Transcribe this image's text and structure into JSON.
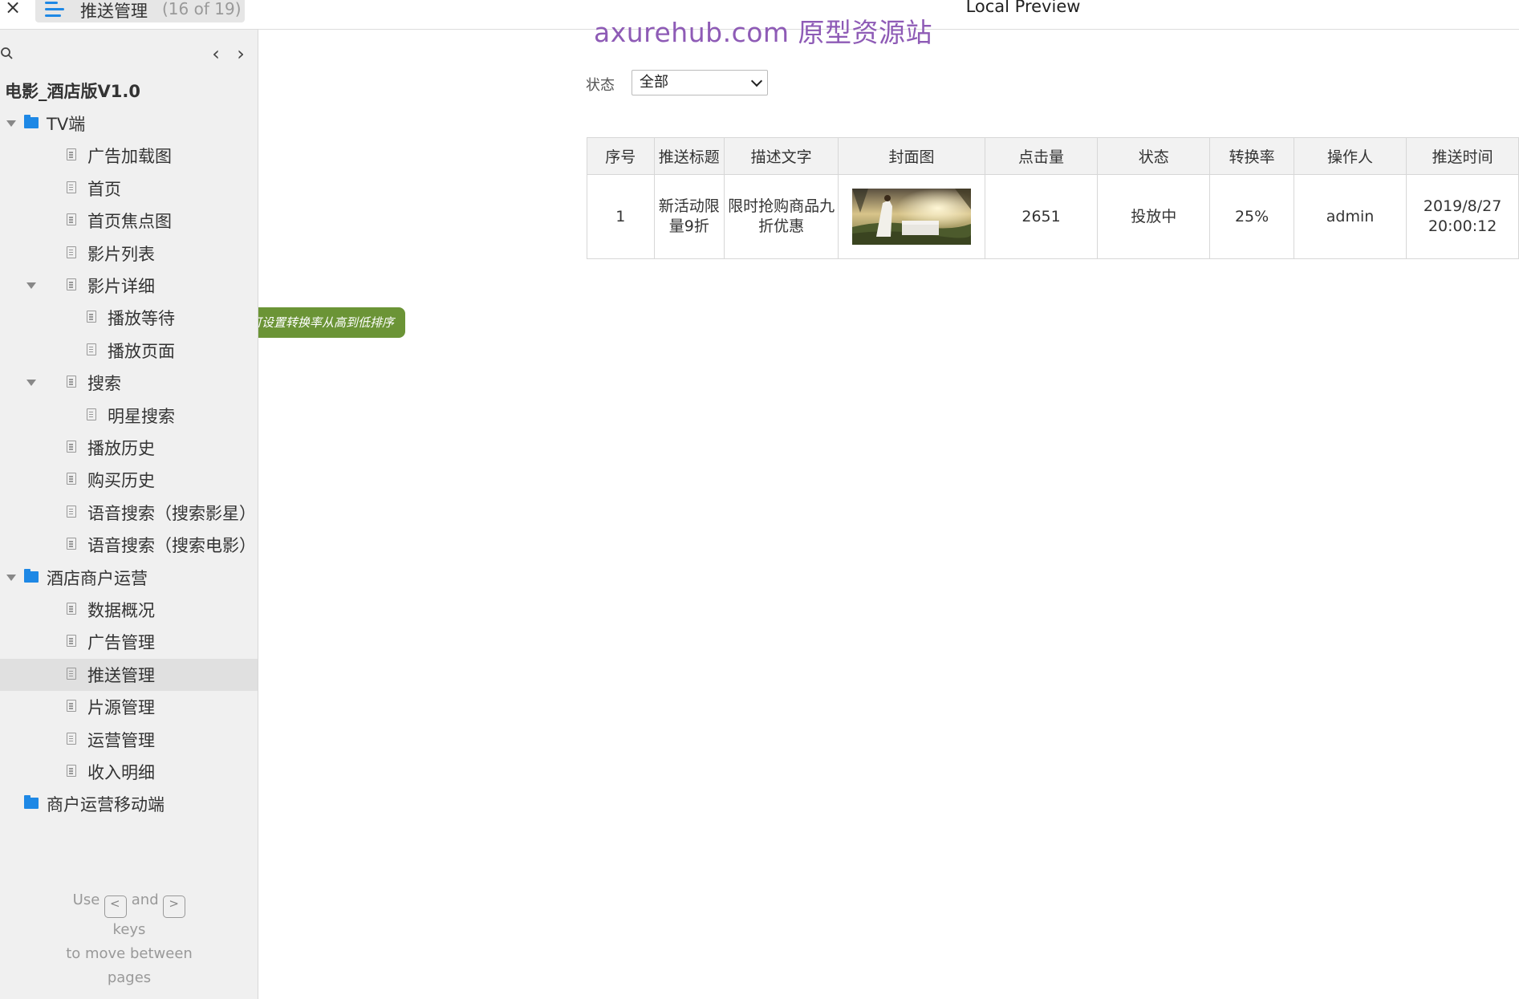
{
  "topbar": {
    "close_glyph": "×",
    "page_name": "推送管理",
    "page_count": "(16 of 19)",
    "preview_title": "Local Preview",
    "watermark": "axurehub.com 原型资源站"
  },
  "sidebar": {
    "prev_glyph": "‹",
    "next_glyph": "›",
    "project_title": "电影_酒店版V1.0",
    "items": [
      {
        "label": "TV端",
        "type": "folder",
        "expanded": true
      },
      {
        "label": "广告加载图",
        "type": "page"
      },
      {
        "label": "首页",
        "type": "page"
      },
      {
        "label": "首页焦点图",
        "type": "page"
      },
      {
        "label": "影片列表",
        "type": "page"
      },
      {
        "label": "影片详细",
        "type": "page",
        "expanded": true
      },
      {
        "label": "播放等待",
        "type": "page"
      },
      {
        "label": "播放页面",
        "type": "page"
      },
      {
        "label": "搜索",
        "type": "page",
        "expanded": true
      },
      {
        "label": "明星搜索",
        "type": "page"
      },
      {
        "label": "播放历史",
        "type": "page"
      },
      {
        "label": "购买历史",
        "type": "page"
      },
      {
        "label": "语音搜索（搜索影星）",
        "type": "page"
      },
      {
        "label": "语音搜索（搜索电影）",
        "type": "page"
      },
      {
        "label": "酒店商户运营",
        "type": "folder",
        "expanded": true
      },
      {
        "label": "数据概况",
        "type": "page"
      },
      {
        "label": "广告管理",
        "type": "page"
      },
      {
        "label": "推送管理",
        "type": "page",
        "selected": true
      },
      {
        "label": "片源管理",
        "type": "page"
      },
      {
        "label": "运营管理",
        "type": "page"
      },
      {
        "label": "收入明细",
        "type": "page"
      },
      {
        "label": "商户运营移动端",
        "type": "folder"
      }
    ],
    "hint": {
      "use": "Use",
      "and": "and",
      "keys": "keys",
      "to_move": "to move between",
      "pages": "pages",
      "left_key": "<",
      "right_key": ">"
    }
  },
  "filter": {
    "label": "状态",
    "selected": "全部"
  },
  "table": {
    "headers": [
      "序号",
      "推送标题",
      "描述文字",
      "封面图",
      "点击量",
      "状态",
      "转换率",
      "操作人",
      "推送时间"
    ],
    "rows": [
      {
        "index": "1",
        "title_line1": "新活动限",
        "title_line2": "量9折",
        "desc_line1": "限时抢购商品九",
        "desc_line2": "折优惠",
        "cover": "cover-image",
        "clicks": "2651",
        "status": "投放中",
        "conversion": "25%",
        "operator": "admin",
        "time_line1": "2019/8/27",
        "time_line2": "20:00:12"
      }
    ]
  },
  "tooltip": {
    "text": "可设置转换率从高到低排序"
  },
  "colors": {
    "accent": "#1e88e5",
    "tag_green": "#6b9436",
    "watermark": "#8e5bb6"
  }
}
